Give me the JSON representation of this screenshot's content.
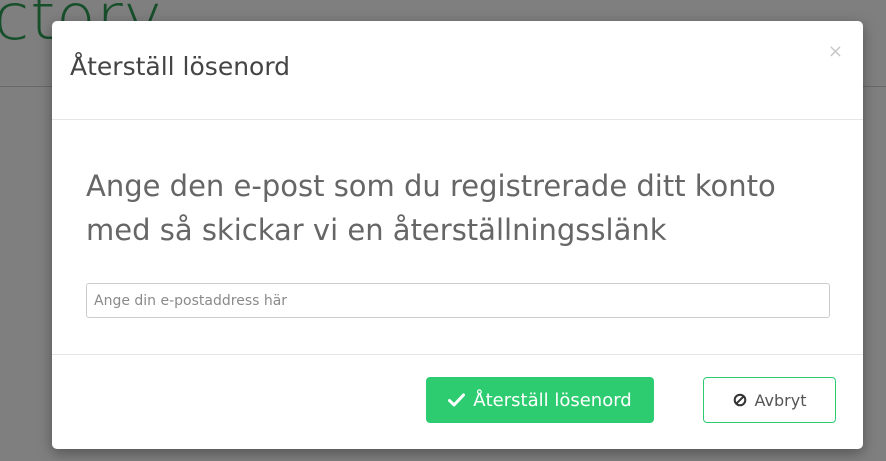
{
  "background": {
    "logo_text": "ctory"
  },
  "modal": {
    "title": "Återställ lösenord",
    "close_label": "×",
    "prompt": "Ange den e-post som du registrerade ditt konto med så skickar vi en återställningsslänk",
    "email_field": {
      "value": "",
      "placeholder": "Ange din e-postaddress här"
    },
    "reset_button": {
      "label": "Återställ lösenord",
      "icon": "check-icon"
    },
    "cancel_button": {
      "label": "Avbryt",
      "icon": "ban-icon"
    }
  },
  "colors": {
    "accent": "#2ecc71",
    "logo": "#2e9e56",
    "backdrop": "rgba(0,0,0,0.5)"
  }
}
